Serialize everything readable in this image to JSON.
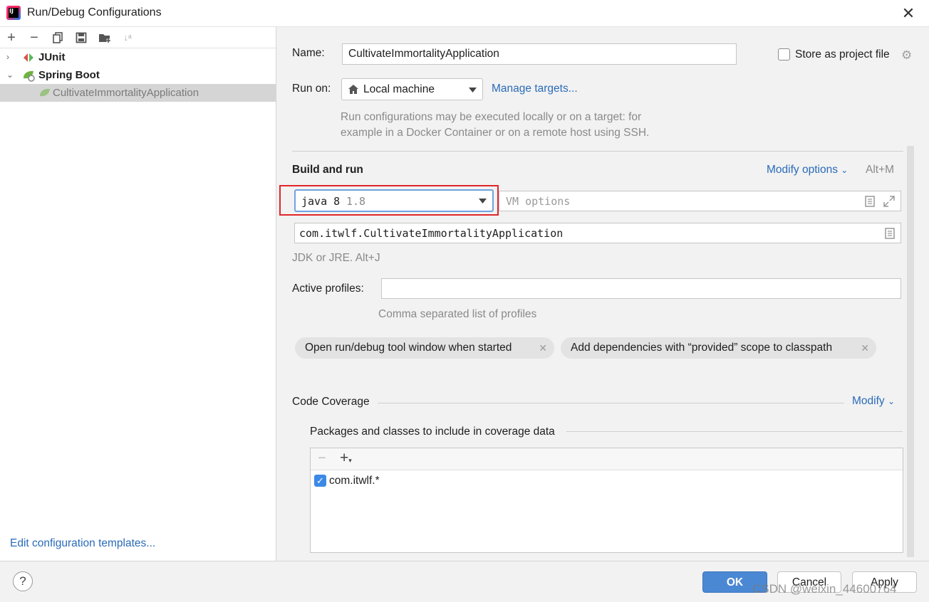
{
  "window": {
    "title": "Run/Debug Configurations"
  },
  "toolbar": {
    "add": "+",
    "remove": "−",
    "copy_icon": "copy-icon",
    "save_icon": "save-icon",
    "folder_icon": "new-folder-icon",
    "sort_icon": "sort-icon"
  },
  "tree": {
    "items": [
      {
        "label": "JUnit",
        "expanded": false
      },
      {
        "label": "Spring Boot",
        "expanded": true
      },
      {
        "label": "CultivateImmortalityApplication",
        "selected": true
      }
    ]
  },
  "left_footer": {
    "edit_templates": "Edit configuration templates..."
  },
  "form": {
    "name_label": "Name:",
    "name_value": "CultivateImmortalityApplication",
    "store_label": "Store as project file",
    "run_on_label": "Run on:",
    "run_on_value": "Local machine",
    "manage_targets": "Manage targets...",
    "run_hint_line1": "Run configurations may be executed locally or on a target: for",
    "run_hint_line2": "example in a Docker Container or on a remote host using SSH.",
    "build_and_run": "Build and run",
    "modify_options": "Modify options",
    "modify_options_shortcut": "Alt+M",
    "jdk_value": "java 8",
    "jdk_version": "1.8",
    "vm_options_placeholder": "VM options",
    "main_class": "com.itwlf.CultivateImmortalityApplication",
    "jdk_hint": "JDK or JRE. Alt+J",
    "active_profiles_label": "Active profiles:",
    "active_profiles_value": "",
    "profiles_hint": "Comma separated list of profiles",
    "chips": [
      "Open run/debug tool window when started",
      "Add dependencies with “provided” scope to classpath"
    ],
    "code_coverage": "Code Coverage",
    "modify": "Modify",
    "packages_label": "Packages and classes to include in coverage data",
    "packages": [
      {
        "pattern": "com.itwlf.*",
        "checked": true
      }
    ]
  },
  "buttons": {
    "help": "?",
    "ok": "OK",
    "cancel": "Cancel",
    "apply": "Apply"
  },
  "watermark": "CSDN @weixin_44600764",
  "colors": {
    "accent": "#4a88d4",
    "link": "#2a6bb8",
    "highlight_border": "#e0262b"
  }
}
